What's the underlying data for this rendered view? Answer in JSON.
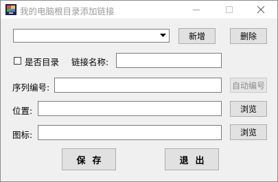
{
  "window": {
    "title": "我的电脑根目录添加链接",
    "minimize_icon": "minimize-icon",
    "maximize_icon": "maximize-icon",
    "close_icon": "close-icon"
  },
  "top_row": {
    "dropdown_value": "",
    "add_label": "新增",
    "delete_label": "删除"
  },
  "directory_row": {
    "is_directory_label": "是否目录",
    "is_directory_checked": false,
    "link_name_label": "链接名称:",
    "link_name_value": ""
  },
  "sequence_row": {
    "label": "序列编号:",
    "value": "",
    "auto_number_label": "自动编号"
  },
  "location_row": {
    "label": "位置:",
    "value": "",
    "browse_label": "浏览"
  },
  "icon_row": {
    "label": "图标:",
    "value": "",
    "browse_label": "浏览"
  },
  "bottom": {
    "save_label": "保存",
    "exit_label": "退出"
  },
  "colors": {
    "window_bg": "#f0f0f0",
    "titlebar_bg": "#ffffff",
    "title_text": "#9a9a9a",
    "button_bg": "#e1e1e1",
    "disabled_text": "#8d8d8d"
  }
}
